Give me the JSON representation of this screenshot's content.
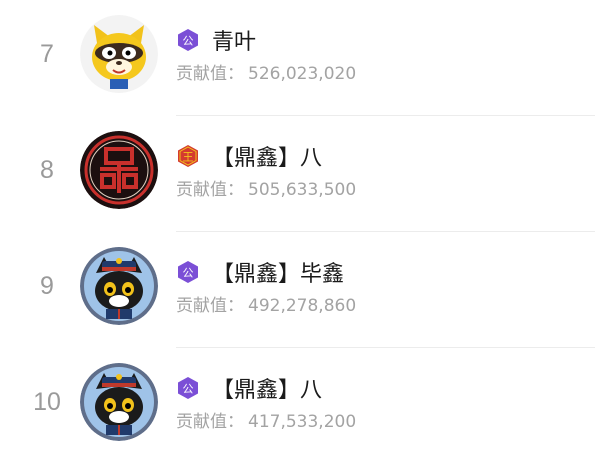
{
  "contribution_label": "贡献值：",
  "rows": [
    {
      "rank": "7",
      "name": "青叶",
      "value": "526,023,020",
      "badge": "公",
      "badge_color": "#7b4fd6",
      "avatar": "raccoon-avatar"
    },
    {
      "rank": "8",
      "name": "【鼎鑫】八",
      "value": "505,633,500",
      "badge": "王",
      "badge_color": "#d43a2f",
      "avatar": "red-seal-avatar"
    },
    {
      "rank": "9",
      "name": "【鼎鑫】毕鑫",
      "value": "492,278,860",
      "badge": "公",
      "badge_color": "#7b4fd6",
      "avatar": "cat-officer-avatar"
    },
    {
      "rank": "10",
      "name": "【鼎鑫】八",
      "value": "417,533,200",
      "badge": "公",
      "badge_color": "#7b4fd6",
      "avatar": "cat-officer-avatar"
    }
  ]
}
